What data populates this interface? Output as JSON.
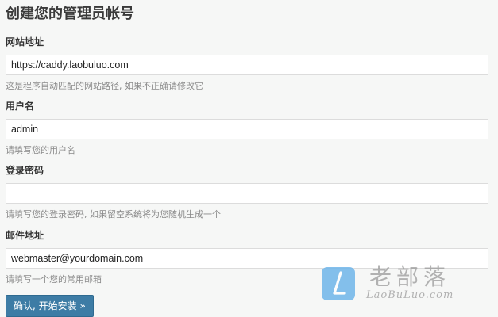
{
  "page": {
    "title": "创建您的管理员帐号"
  },
  "fields": {
    "site_url": {
      "label": "网站地址",
      "value": "https://caddy.laobuluo.com",
      "hint": "这是程序自动匹配的网站路径, 如果不正确请修改它"
    },
    "username": {
      "label": "用户名",
      "value": "admin",
      "hint": "请填写您的用户名"
    },
    "password": {
      "label": "登录密码",
      "value": "",
      "hint": "请填写您的登录密码, 如果留空系统将为您随机生成一个"
    },
    "email": {
      "label": "邮件地址",
      "value": "webmaster@yourdomain.com",
      "hint": "请填写一个您的常用邮箱"
    }
  },
  "actions": {
    "submit_label": "确认, 开始安装 »"
  },
  "watermark": {
    "brand": "老部落",
    "domain": "LaoBuLuo.com"
  },
  "colors": {
    "background": "#f6f7f6",
    "button": "#3d7ca5",
    "watermark_logo": "#6fb6ea"
  }
}
